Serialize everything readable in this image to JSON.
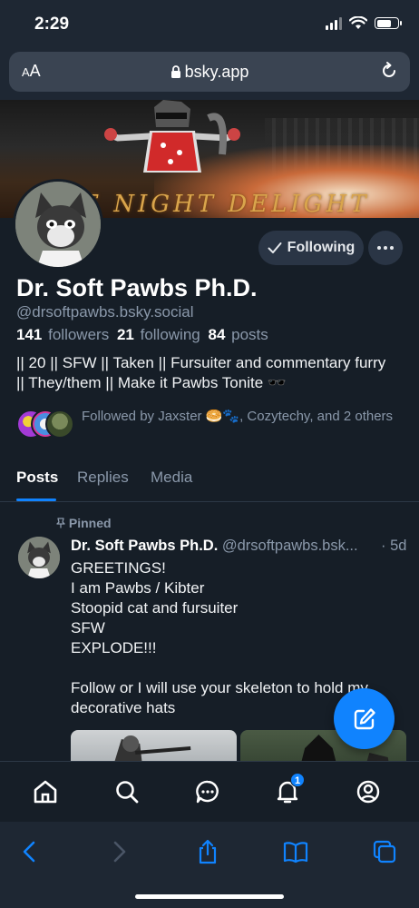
{
  "status_bar": {
    "time": "2:29"
  },
  "browser": {
    "aa_label": "AA",
    "url": "bsky.app"
  },
  "banner": {
    "caption": "E NIGHT DELIGHT"
  },
  "profile": {
    "following_label": "Following",
    "display_name": "Dr. Soft Pawbs Ph.D.",
    "handle": "@drsoftpawbs.bsky.social",
    "followers_count": "141",
    "followers_label": "followers",
    "following_count": "21",
    "following_count_label": "following",
    "posts_count": "84",
    "posts_label": "posts",
    "bio": "|| 20 || SFW || Taken || Fursuiter and commentary furry || They/them || Make it Pawbs Tonite 🕶️",
    "followed_by": "Followed by Jaxster 🥯🐾, Cozytechy, and 2 others"
  },
  "tabs": [
    {
      "label": "Posts",
      "active": true
    },
    {
      "label": "Replies",
      "active": false
    },
    {
      "label": "Media",
      "active": false
    }
  ],
  "post": {
    "pinned_label": "Pinned",
    "author": "Dr. Soft Pawbs Ph.D.",
    "handle": "@drsoftpawbs.bsk...",
    "time": "· 5d",
    "text": "GREETINGS!\nI am Pawbs / Kibter\nStoopid cat and fursuiter\nSFW\nEXPLODE!!!\n\nFollow or I will use your skeleton to hold my decorative hats"
  },
  "bottom_nav": {
    "items": [
      "home-icon",
      "search-icon",
      "chat-icon",
      "notifications-icon",
      "profile-icon"
    ],
    "notification_badge": "1"
  },
  "safari_toolbar": {
    "items": [
      "back-icon",
      "forward-icon",
      "share-icon",
      "bookmarks-icon",
      "tabs-icon"
    ]
  },
  "colors": {
    "background": "#161e27",
    "accent": "#1083fe",
    "muted_text": "#8a98aa",
    "chrome": "#1e2733"
  }
}
